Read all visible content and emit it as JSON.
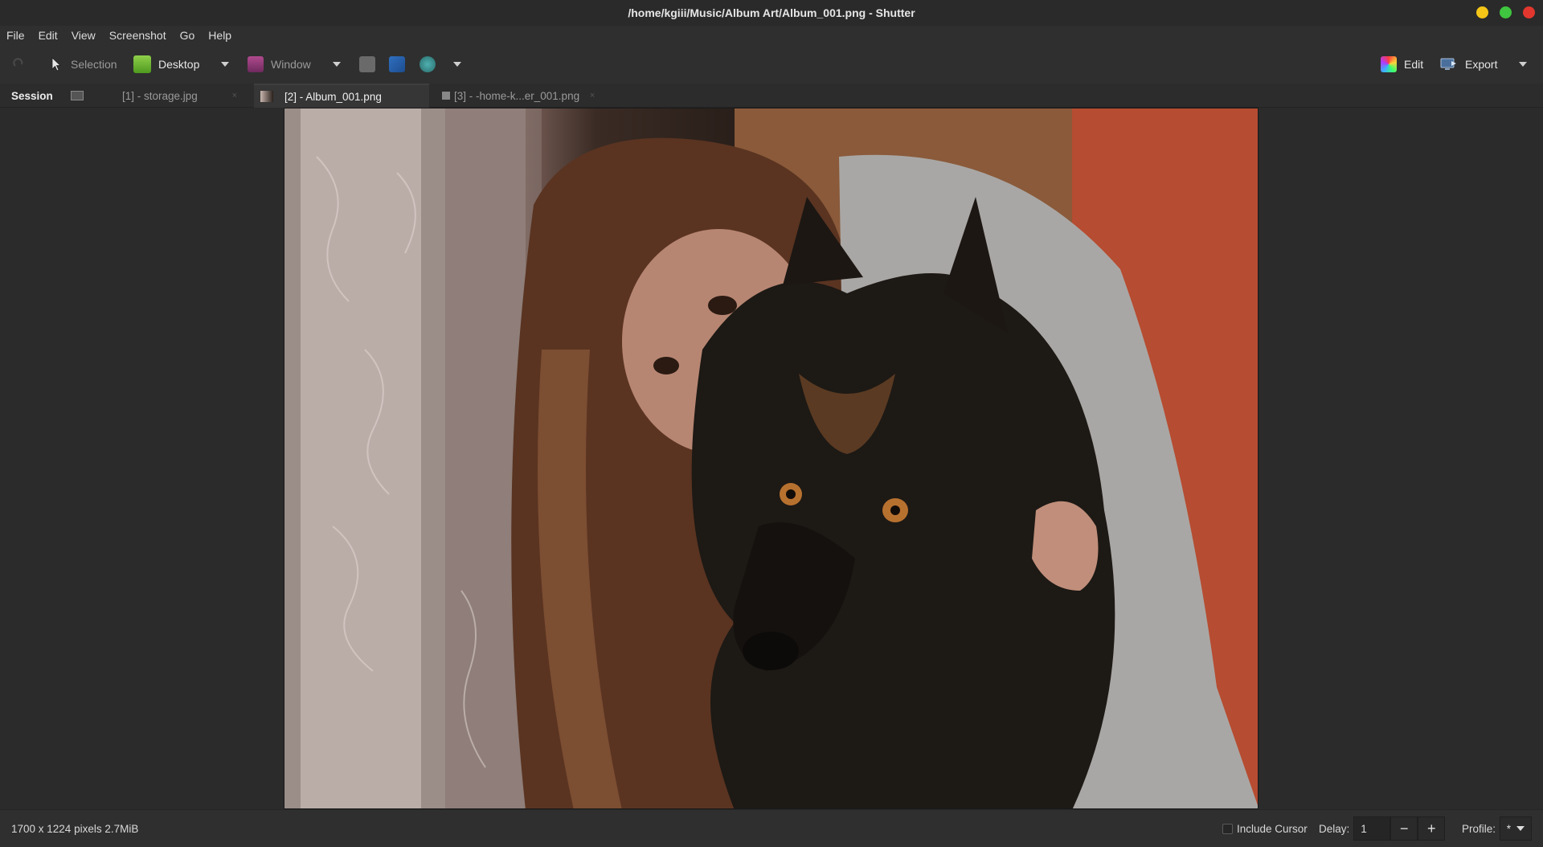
{
  "window": {
    "title": "/home/kgiii/Music/Album Art/Album_001.png - Shutter"
  },
  "menu": {
    "items": [
      "File",
      "Edit",
      "View",
      "Screenshot",
      "Go",
      "Help"
    ]
  },
  "toolbar": {
    "selection_label": "Selection",
    "desktop_label": "Desktop",
    "window_label": "Window",
    "edit_label": "Edit",
    "export_label": "Export"
  },
  "tabs": {
    "session_label": "Session",
    "items": [
      {
        "label": "[1] - storage.jpg"
      },
      {
        "label": "[2] - Album_001.png"
      },
      {
        "label": "[3] - -home-k...er_001.png"
      }
    ],
    "active_index": 1
  },
  "viewer": {
    "icon": "photo-woman-with-dog"
  },
  "status": {
    "info": "1700 x 1224 pixels  2.7MiB",
    "include_cursor_label": "Include Cursor",
    "include_cursor_checked": false,
    "delay_label": "Delay:",
    "delay_value": "1",
    "minus": "−",
    "plus": "+",
    "profile_label": "Profile:",
    "profile_value": "*"
  },
  "colors": {
    "accent_min": "#f5c518",
    "accent_max": "#3fc53f",
    "accent_close": "#e2372e"
  }
}
